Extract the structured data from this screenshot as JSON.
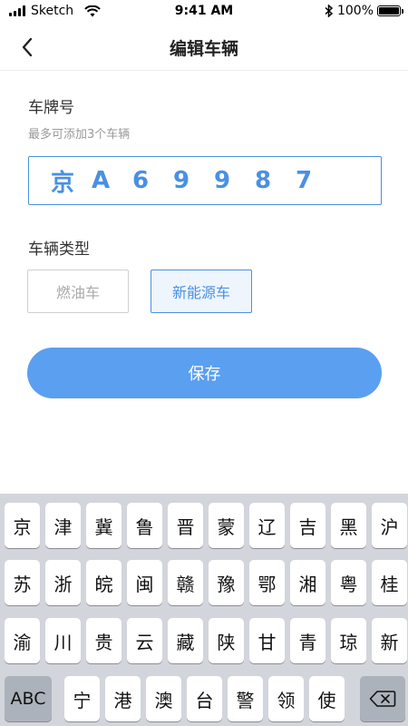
{
  "status_bar": {
    "carrier": "Sketch",
    "time": "9:41 AM",
    "battery": "100%",
    "battery_level": 1.0
  },
  "nav": {
    "title": "编辑车辆",
    "back_icon": "chevron-left-icon"
  },
  "form": {
    "plate_label": "车牌号",
    "plate_hint": "最多可添加3个车辆",
    "plate_chars": [
      "京",
      "A",
      "6",
      "9",
      "9",
      "8",
      "7"
    ],
    "type_label": "车辆类型",
    "types": [
      {
        "label": "燃油车",
        "selected": false
      },
      {
        "label": "新能源车",
        "selected": true
      }
    ],
    "save_label": "保存"
  },
  "keyboard": {
    "rows": [
      [
        "京",
        "津",
        "冀",
        "鲁",
        "晋",
        "蒙",
        "辽",
        "吉",
        "黑",
        "沪"
      ],
      [
        "苏",
        "浙",
        "皖",
        "闽",
        "赣",
        "豫",
        "鄂",
        "湘",
        "粤",
        "桂"
      ],
      [
        "渝",
        "川",
        "贵",
        "云",
        "藏",
        "陕",
        "甘",
        "青",
        "琼",
        "新"
      ],
      [
        "宁",
        "港",
        "澳",
        "台",
        "警",
        "领",
        "使"
      ]
    ],
    "abc_label": "ABC",
    "delete_icon": "backspace-icon"
  },
  "colors": {
    "accent": "#4a90e2",
    "save_button": "#5b9ff0",
    "keyboard_bg": "#d2d5db"
  }
}
